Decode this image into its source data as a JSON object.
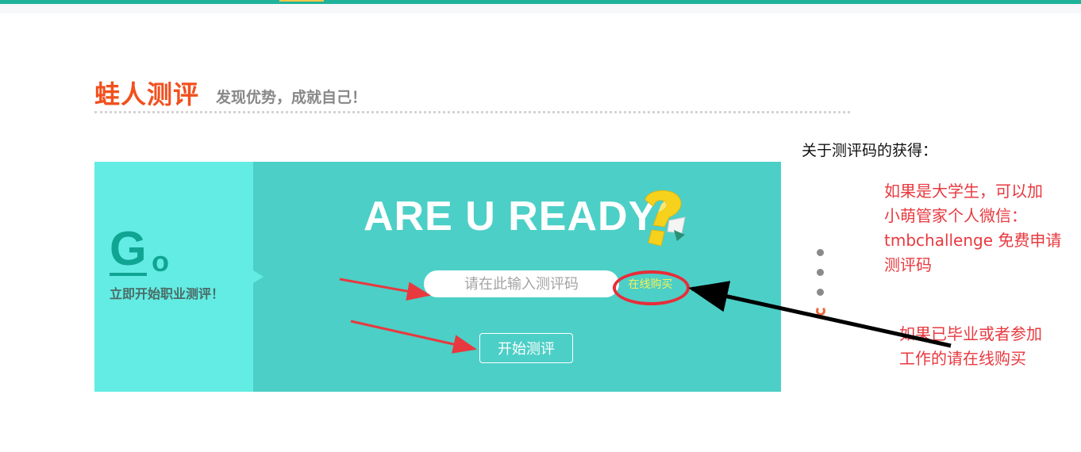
{
  "header": {
    "title": "蛙人测评",
    "subtitle": "发现优势，成就自己！"
  },
  "banner": {
    "go_big": "G",
    "go_small": "o",
    "go_subtitle": "立即开始职业测评！",
    "headline": "ARE U READY",
    "code_input_placeholder": "请在此输入测评码",
    "code_input_value": "",
    "buy_link": "在线购买",
    "start_button": "开始测评"
  },
  "sidebar": {
    "title": "关于测评码的获得："
  },
  "annotations": {
    "note_student_line1": "如果是大学生，可以加",
    "note_student_line2": "小萌管家个人微信：",
    "note_student_line3": "tmbchallenge 免费申请",
    "note_student_line4": "测评码",
    "note_graduate_line1": "如果已毕业或者参加",
    "note_graduate_line2": "工作的请在线购买"
  },
  "colors": {
    "brand_orange": "#f2501e",
    "top_bar": "#1fb39b",
    "banner_bg": "#4ccfc6",
    "banner_left": "#63ece3",
    "annotation_red": "#e8393f",
    "buy_link_text": "#f6f05a"
  },
  "icons": {
    "question_mark": "yellow-question-mark-icon",
    "carousel": "vertical-dots-pager"
  }
}
